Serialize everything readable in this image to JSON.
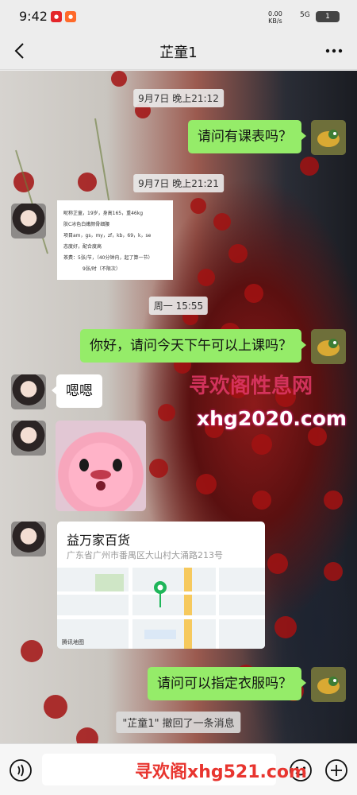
{
  "status_bar": {
    "time": "9:42",
    "net_speed_value": "0.00",
    "net_speed_unit": "KB/s",
    "signal": "5G",
    "battery": "1",
    "app_badges": [
      "app-notification-badge-red",
      "app-notification-badge-orange"
    ]
  },
  "header": {
    "title": "芷童1",
    "back_icon": "chevron-left-icon",
    "more_icon": "more-dots-icon"
  },
  "messages": [
    {
      "type": "timestamp",
      "text": "9月7日 晚上21:12"
    },
    {
      "type": "text",
      "side": "right",
      "text": "请问有课表吗？"
    },
    {
      "type": "timestamp",
      "text": "9月7日 晚上21:21"
    },
    {
      "type": "image",
      "side": "left",
      "lines": [
        "昵称芷童，19岁，身高165，重46kg",
        "肤C冰色白嫩颜骨细腰",
        "项目am，gs，my，zf，kb，69，k，se",
        "态度好，配合度高",
        "茶费：5张/节，（40分钟内，起了算一节）",
        "9张/时（不限次）"
      ]
    },
    {
      "type": "timestamp",
      "text": "周一 15:55"
    },
    {
      "type": "text",
      "side": "right",
      "text": "你好，请问今天下午可以上课吗？"
    },
    {
      "type": "text",
      "side": "left",
      "text": "嗯嗯"
    },
    {
      "type": "sticker",
      "side": "left",
      "description_icon": "pink-beaver-sticker"
    },
    {
      "type": "location",
      "side": "left",
      "name": "益万家百货",
      "address": "广东省广州市番禺区大山村大涌路213号"
    },
    {
      "type": "text",
      "side": "right",
      "text": "请问可以指定衣服吗？"
    },
    {
      "type": "system",
      "text": "\"芷童1\" 撤回了一条消息"
    }
  ],
  "map_labels": [
    "市政公园",
    "百货大楼",
    "东信",
    "华夏商业城",
    "岭南大道",
    "广州公安局",
    "佳运大厦"
  ],
  "map_logo": "腾讯地图",
  "watermarks": [
    "寻欢阁性息网",
    "xhg2020.com",
    "寻欢阁xhg521.com"
  ],
  "input_bar": {
    "voice_icon": "voice-icon",
    "emoji_icon": "emoji-icon",
    "plus_icon": "plus-icon",
    "placeholder": ""
  },
  "colors": {
    "accent_green": "#95ec69",
    "nav_bg": "#ededed",
    "bubble_white": "#ffffff",
    "map_pin": "#1fb65a"
  }
}
